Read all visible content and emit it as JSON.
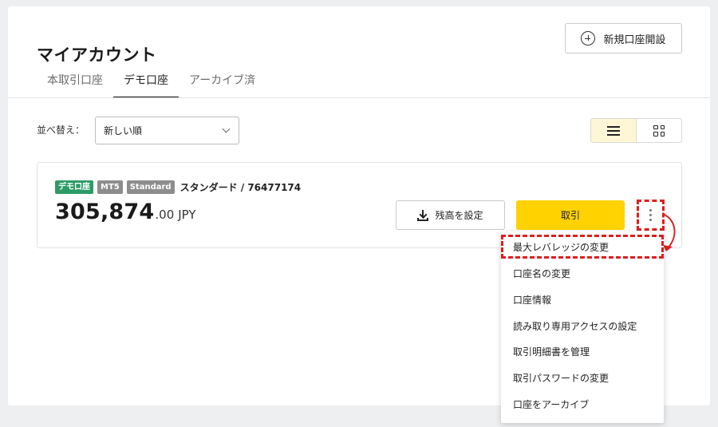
{
  "header": {
    "title": "マイアカウント",
    "new_account_label": "新規口座開設"
  },
  "tabs": [
    {
      "label": "本取引口座",
      "active": false
    },
    {
      "label": "デモ口座",
      "active": true
    },
    {
      "label": "アーカイブ済",
      "active": false
    }
  ],
  "sort": {
    "label": "並べ替え：",
    "selected": "新しい順"
  },
  "view_toggle": {
    "active": "list",
    "list_icon": "list-icon",
    "grid_icon": "grid-icon"
  },
  "account": {
    "badges": [
      "デモ口座",
      "MT5",
      "Standard"
    ],
    "name": "スタンダード / 76477174",
    "balance_main": "305,874",
    "balance_decimal": ".00",
    "currency": "JPY",
    "set_balance_label": "残高を設定",
    "trade_label": "取引"
  },
  "menu": {
    "items": [
      "最大レバレッジの変更",
      "口座名の変更",
      "口座情報",
      "読み取り専用アクセスの設定",
      "取引明細書を管理",
      "取引パスワードの変更",
      "口座をアーカイブ"
    ],
    "highlighted_index": 0
  },
  "colors": {
    "accent_yellow": "#ffd200",
    "demo_badge": "#2e9b67",
    "annotation_red": "#dd1f1f"
  }
}
